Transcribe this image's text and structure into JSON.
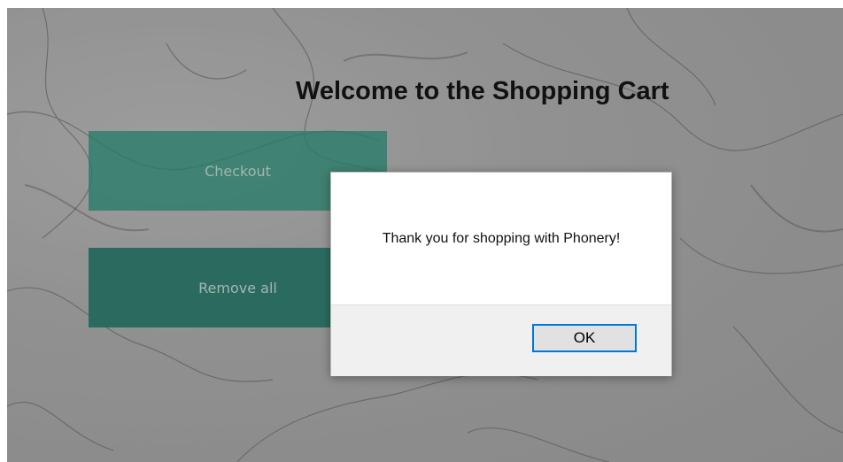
{
  "page": {
    "title": "Welcome to the Shopping Cart",
    "buttons": {
      "checkout": "Checkout",
      "remove_all": "Remove all"
    }
  },
  "dialog": {
    "message": "Thank you for shopping with Phonery!",
    "ok_label": "OK"
  },
  "colors": {
    "button_green": "#2b6b5f",
    "dialog_focus": "#0078d7"
  }
}
